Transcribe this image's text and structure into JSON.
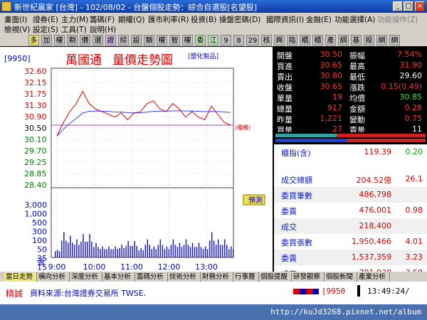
{
  "window": {
    "title": "新世紀贏家 [台灣] - 102/08/02 - 台盤個股走勢：綜合自選股[名望股]"
  },
  "menu": {
    "row1": [
      "畫面(I)",
      "證券(E)",
      "主力(M)",
      "籌碼(F)",
      "期權(Q)",
      "匯市利率(R)",
      "投資(B)",
      "操盤密碼(D)",
      "國際資訊(I)",
      "金融(E)",
      "功能選擇(A)",
      "功能操作(Z)"
    ],
    "row2": [
      "檢視(V)",
      "設定(S)",
      "工具(T)",
      "說明(H)"
    ]
  },
  "toolbar": {
    "buttons": [
      "多",
      "加",
      "權",
      "期",
      "價",
      "選",
      "證",
      "綜",
      "設",
      "類",
      "權",
      "智",
      "權",
      "委",
      "江",
      "9",
      "8",
      "29",
      "核",
      "興",
      "指",
      "櫃",
      "櫃",
      "產",
      "綱",
      "基",
      "投",
      "網",
      "網"
    ]
  },
  "chart": {
    "code": "[9950]",
    "name": "萬國通",
    "title": "量價走勢圖",
    "tag": "[塑化製品]",
    "ref_tag": "(櫃檯)",
    "forecast_label": "預測",
    "vol_unit": "張",
    "price_ticks": [
      "32.60",
      "32.15",
      "31.75",
      "31.30",
      "30.90",
      "30.50",
      "30.10",
      "29.70",
      "29.25",
      "28.85",
      "28.40"
    ],
    "vol_ticks": [
      "3,000",
      "1,000",
      "500",
      "300",
      "100",
      "50",
      "35",
      "15"
    ],
    "time_ticks": [
      "9:00",
      "10:00",
      "11:00",
      "12:00",
      "13:00"
    ]
  },
  "chart_data": {
    "type": "line",
    "x": [
      "9:00",
      "9:10",
      "9:20",
      "9:30",
      "9:40",
      "9:50",
      "10:00",
      "10:10",
      "10:20",
      "10:30",
      "10:40",
      "10:50",
      "11:00",
      "11:10",
      "11:20",
      "11:30",
      "11:40",
      "11:50",
      "12:00",
      "12:10",
      "12:20",
      "12:30",
      "12:40",
      "12:50",
      "13:00",
      "13:10",
      "13:20",
      "13:30"
    ],
    "series": [
      {
        "values": [
          30.1,
          30.6,
          31.0,
          31.3,
          31.75,
          31.3,
          31.1,
          31.0,
          30.9,
          30.8,
          30.95,
          30.7,
          30.95,
          31.0,
          31.3,
          31.4,
          31.1,
          31.0,
          31.3,
          31.1,
          30.8,
          31.0,
          30.8,
          30.7,
          31.2,
          30.9,
          30.6,
          30.5
        ]
      }
    ],
    "ref_price": 30.5,
    "ylim": [
      28.4,
      32.6
    ]
  },
  "quote": {
    "rows": [
      {
        "l1": "開盤",
        "v1": "30.50",
        "l2": "振幅",
        "v2": "7.54%"
      },
      {
        "l1": "買進",
        "v1": "30.65",
        "l2": "最高",
        "v2": "31.90"
      },
      {
        "l1": "賣出",
        "v1": "30.80",
        "l2": "最低",
        "v2": "29.60"
      },
      {
        "l1": "收盤",
        "v1": "30.65",
        "l2": "漲跌",
        "v2": "0.15(0.49)"
      },
      {
        "l1": "單量",
        "v1": "19",
        "l2": "均價",
        "v2": "30.85"
      },
      {
        "l1": "總量",
        "v1": "917",
        "l2": "金額",
        "v2": "0.28"
      },
      {
        "l1": "昨量",
        "v1": "1,221",
        "l2": "變動",
        "v2": "0.75"
      },
      {
        "l1": "買量",
        "v1": "27",
        "l2": "賣量",
        "v2": "11"
      }
    ]
  },
  "lower": {
    "header": {
      "label": "櫃指(含)",
      "value": "119.39",
      "right": "0.20"
    },
    "rows": [
      {
        "label": "成交總額",
        "value": "204.52億",
        "right": "26.1"
      },
      {
        "label": "委買筆數",
        "value": "486,798",
        "right": ""
      },
      {
        "label": "委賣",
        "value": "476,001",
        "right": "0.98"
      },
      {
        "label": "成交",
        "value": "218,400",
        "right": ""
      },
      {
        "label": "委買張數",
        "value": "1,950,466",
        "right": "4.01"
      },
      {
        "label": "委賣",
        "value": "1,537,359",
        "right": "3.23"
      },
      {
        "label": "成交",
        "value": "781,938",
        "right": "3.58"
      }
    ]
  },
  "tabs": [
    "當日走勢",
    "橫向分析",
    "深度分析",
    "基本分析",
    "籌碼分析",
    "技術分析",
    "財務分析",
    "行事曆",
    "個股提醒",
    "研發觀察",
    "個股新聞",
    "產業分析"
  ],
  "status": {
    "label": "精誠",
    "source": "資料來源:台灣證券交易所 TWSE.",
    "code": "[9950",
    "time": "13:49:24/"
  },
  "watermark": "http://kuJd3268.pixnet.net/album",
  "colors": {
    "price_line": "#e00000",
    "avg_line": "#3040ff",
    "ref_line": "#a040c0",
    "vol_bar": "#2020c0"
  }
}
